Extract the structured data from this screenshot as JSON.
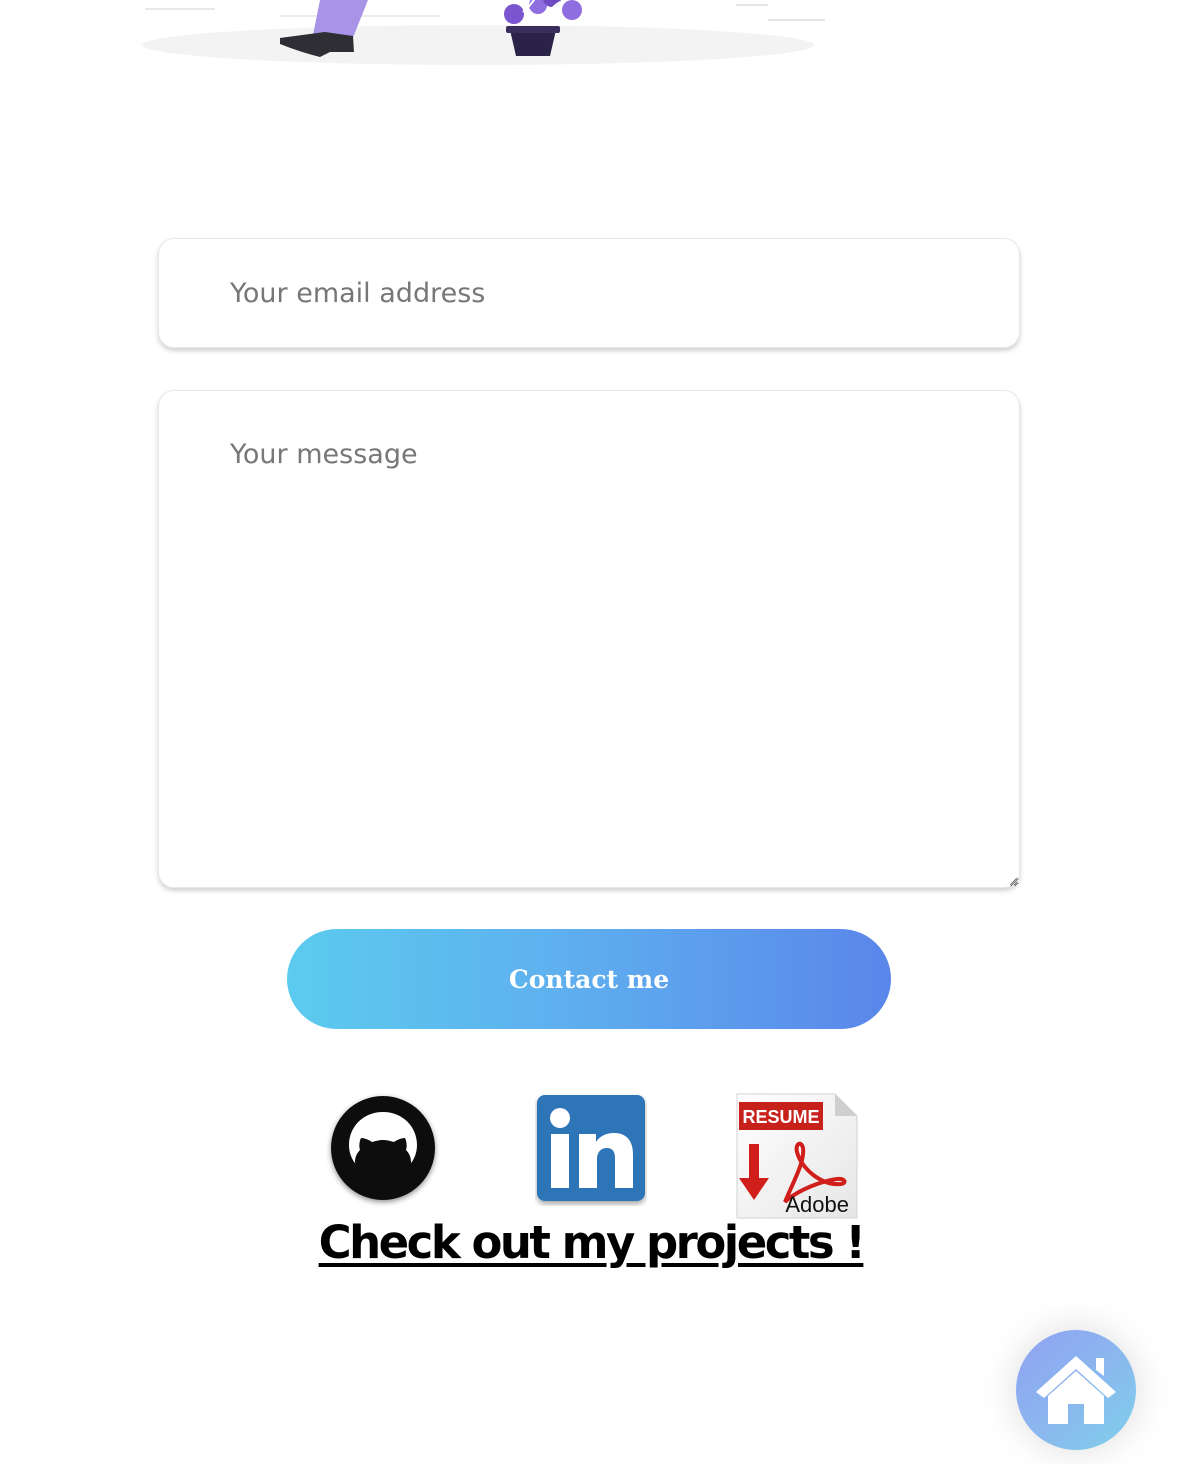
{
  "contact_form": {
    "email_placeholder": "Your email address",
    "message_placeholder": "Your message",
    "submit_label": "Contact me"
  },
  "social_links": {
    "github_icon": "github-icon",
    "linkedin_icon": "linkedin-icon",
    "resume": {
      "icon": "resume-pdf-icon",
      "badge_text": "RESUME",
      "brand_text": "Adobe"
    }
  },
  "projects_link": {
    "label": "Check out my projects !"
  },
  "home_button": {
    "icon": "home-icon"
  },
  "colors": {
    "button_gradient_start": "#5ccbee",
    "button_gradient_end": "#5a86ea",
    "home_gradient_start": "#8fa2f2",
    "home_gradient_end": "#7fd0ea",
    "illustration_accent": "#8f6ee0",
    "linkedin_blue": "#2d74b7",
    "resume_red": "#c8211c"
  }
}
